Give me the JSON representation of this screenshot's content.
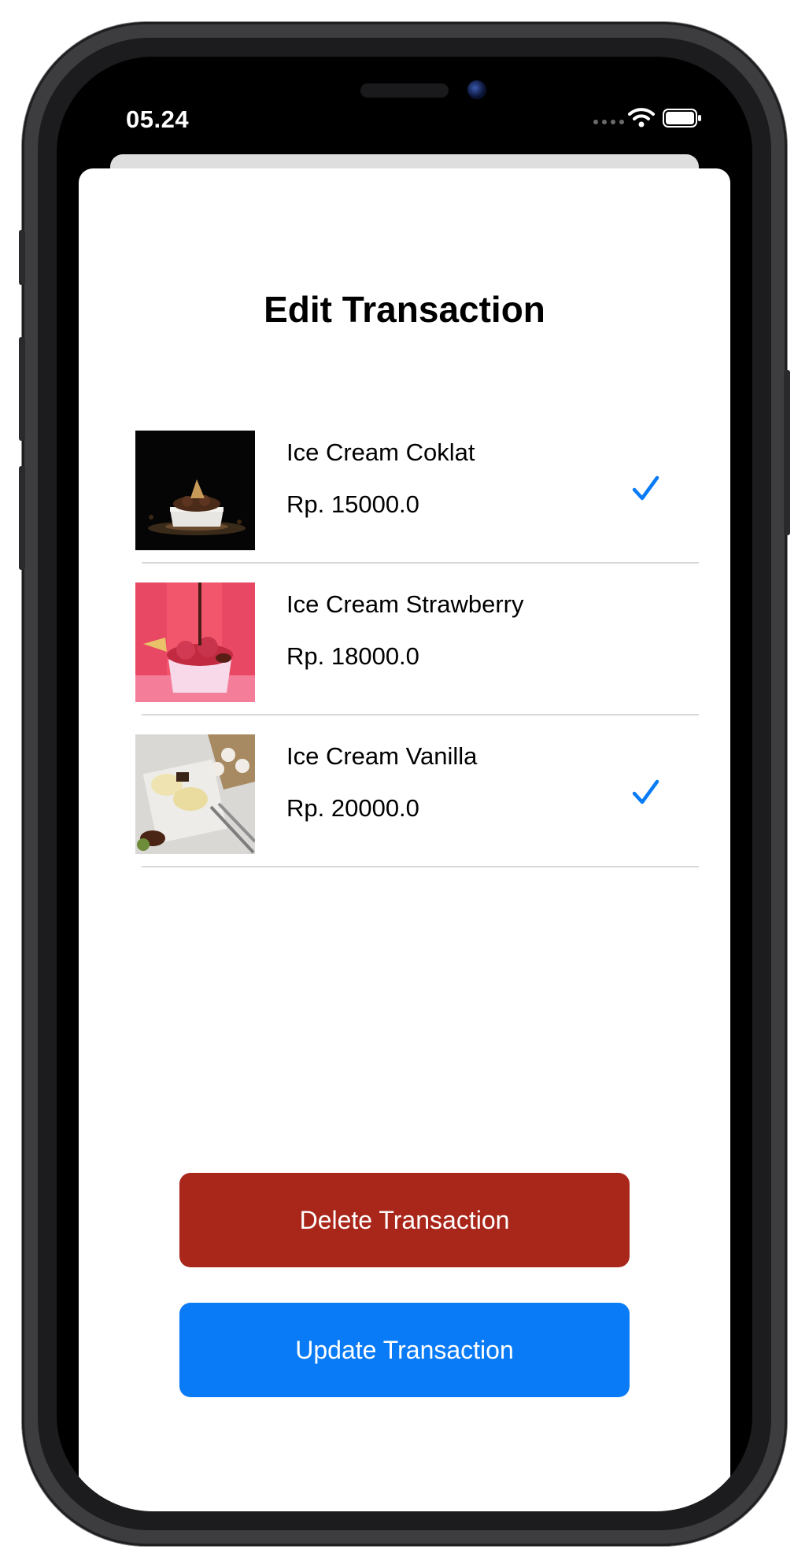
{
  "status_bar": {
    "time": "05.24"
  },
  "screen": {
    "title": "Edit Transaction"
  },
  "items": [
    {
      "name": "Ice Cream Coklat",
      "price": "Rp. 15000.0",
      "selected": true
    },
    {
      "name": "Ice Cream Strawberry",
      "price": "Rp. 18000.0",
      "selected": false
    },
    {
      "name": "Ice Cream Vanilla",
      "price": "Rp. 20000.0",
      "selected": true
    }
  ],
  "buttons": {
    "delete_label": "Delete Transaction",
    "update_label": "Update Transaction"
  },
  "colors": {
    "accent": "#0a7bf6",
    "delete": "#a9261a",
    "checkmark": "#0a7bf6"
  },
  "icons": {
    "wifi": "wifi-icon",
    "battery": "battery-icon",
    "check": "checkmark-icon"
  }
}
